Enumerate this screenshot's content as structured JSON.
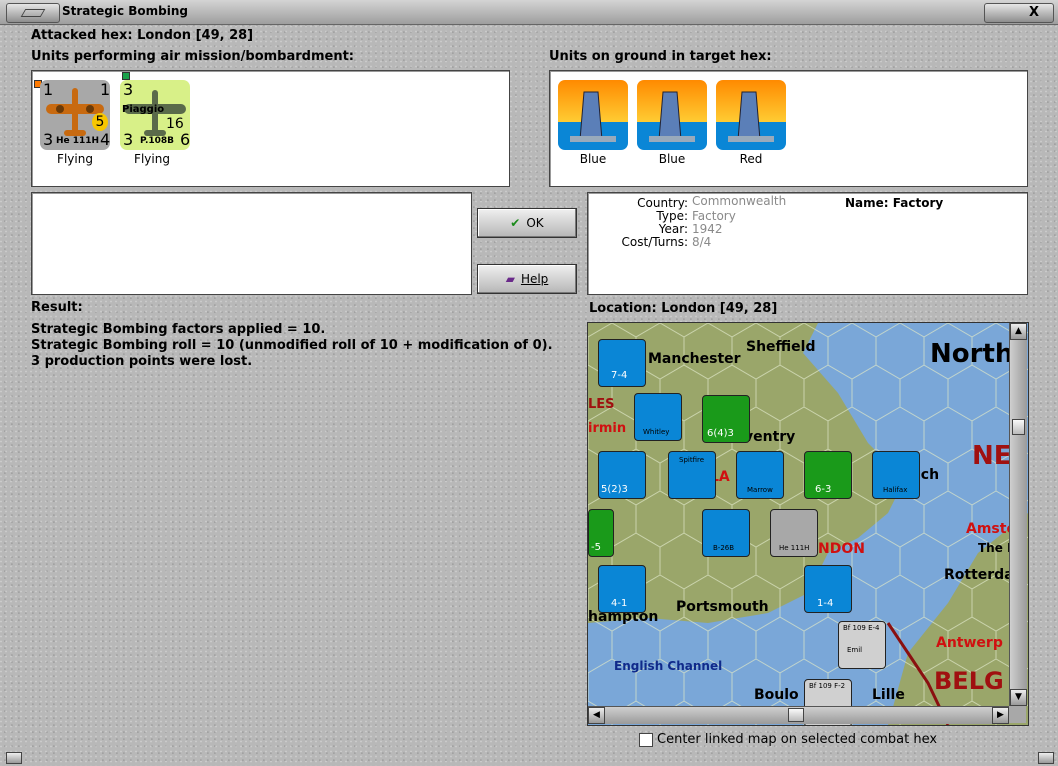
{
  "window": {
    "title": "Strategic Bombing",
    "close_label": "X"
  },
  "attacked_hex": "Attacked hex: London  [49, 28]",
  "air_units_label": "Units performing air mission/bombardment:",
  "ground_units_label": "Units on ground in target hex:",
  "air_units": [
    {
      "tl": "1",
      "tr": "1",
      "bl": "3",
      "br": "4",
      "badge": "5",
      "type": "He 111H",
      "status": "Flying"
    },
    {
      "tl": "3",
      "tr": "",
      "bl": "3",
      "br": "6",
      "badge": "16",
      "maker": "Piaggio",
      "type": "P.108B",
      "status": "Flying"
    }
  ],
  "ground_units": [
    {
      "label": "Blue"
    },
    {
      "label": "Blue"
    },
    {
      "label": "Red"
    }
  ],
  "buttons": {
    "ok": "OK",
    "help": "Help"
  },
  "info": {
    "country_key": "Country:",
    "country": "Commonwealth",
    "type_key": "Type:",
    "type": "Factory",
    "year_key": "Year:",
    "year": "1942",
    "cost_key": "Cost/Turns:",
    "cost": "8/4",
    "name_key": "Name:",
    "name": "Factory"
  },
  "result": {
    "label": "Result:",
    "lines": [
      "Strategic Bombing factors applied = 10.",
      "Strategic Bombing roll = 10 (unmodified roll of 10 + modification of 0).",
      "3 production points were lost."
    ]
  },
  "location_label": "Location:  London  [49, 28]",
  "map": {
    "places": {
      "manchester": "Manchester",
      "sheffield": "Sheffield",
      "north": "North",
      "coventry": "ventry",
      "norwich": "ich",
      "ne": "NE",
      "amsterdam": "Amste",
      "the": "The I",
      "london": "NDON",
      "rotterdam": "Rotterda",
      "portsmouth": "Portsmouth",
      "southampton": "hampton",
      "antwerp": "Antwerp",
      "english_channel": "English Channel",
      "boulogne": "Boulo",
      "lille": "Lille",
      "belgium": "BELG",
      "les": "LES",
      "birmingham": "irmin",
      "la": "LA"
    },
    "counters": {
      "c1_val": "7-4",
      "c2_val": "5(2)3",
      "c3_val": "6(4)3",
      "c4_val": "6-3",
      "c5_val": "4-1",
      "c6_val": "1-4",
      "c7_val": "-5",
      "whitley": "Whitley",
      "spitfire": "Spitfire",
      "marrow": "Marrow",
      "halifax": "Halifax",
      "b26b": "B-26B",
      "he111h": "He 111H",
      "bf109e": "Bf 109 E-4",
      "bf109f": "Bf 109 F-2",
      "emil": "Emil"
    }
  },
  "center_checkbox_label": "Center linked map on selected combat hex",
  "colors": {
    "unit_gray": "#a8a8a8",
    "unit_yellow": "#d8f088",
    "ground_blue": "#0a86d6",
    "map_sea": "#7aa7d8",
    "map_land": "#9aa66a"
  }
}
